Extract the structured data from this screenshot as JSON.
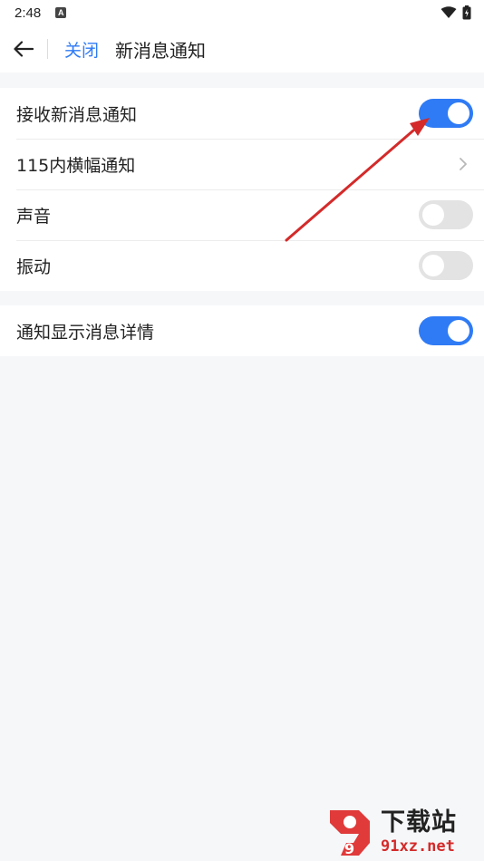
{
  "status_bar": {
    "time": "2:48",
    "a_icon": "A"
  },
  "nav": {
    "back_icon": "arrow-left-icon",
    "close_label": "关闭",
    "title": "新消息通知"
  },
  "groups": [
    {
      "rows": [
        {
          "label": "接收新消息通知",
          "control": "toggle",
          "on": true
        },
        {
          "label": "115内横幅通知",
          "control": "chevron"
        },
        {
          "label": "声音",
          "control": "toggle",
          "on": false
        },
        {
          "label": "振动",
          "control": "toggle",
          "on": false
        }
      ]
    },
    {
      "rows": [
        {
          "label": "通知显示消息详情",
          "control": "toggle",
          "on": true
        }
      ]
    }
  ],
  "colors": {
    "accent": "#2f7bf5",
    "toggle_off": "#e3e3e3",
    "background": "#f6f7f9",
    "annotation_arrow": "#d42a2a"
  },
  "watermark": {
    "logo_text": "9",
    "title": "下载站",
    "url": "91xz.net"
  }
}
